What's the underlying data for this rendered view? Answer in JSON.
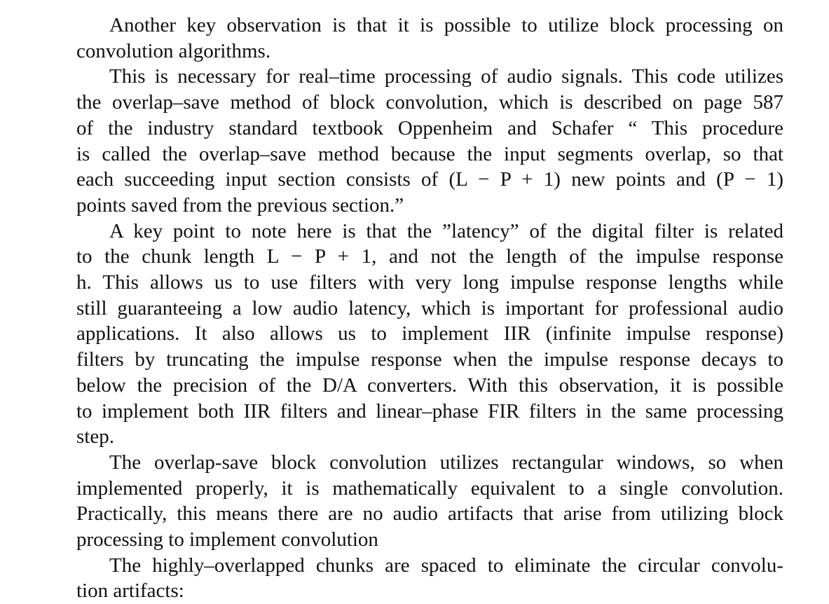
{
  "paragraphs": [
    {
      "lines": [
        "Another key observation is that it is possible to utilize block processing on",
        "convolution algorithms."
      ]
    },
    {
      "lines": [
        "This is necessary for real–time processing of audio signals. This code utilizes",
        "the overlap–save method of block convolution, which is described on page 587",
        "of the industry standard textbook Oppenheim and Schafer “ This procedure",
        "is called the overlap–save method because the input segments overlap, so that",
        "each succeeding input section consists of (L − P + 1) new points and (P − 1)",
        "points saved from the previous section.”"
      ]
    },
    {
      "lines": [
        "A key point to note here is that the ”latency” of the digital filter is related",
        "to the chunk length L − P + 1, and not the length of the impulse response",
        "h. This allows us to use filters with very long impulse response lengths while",
        "still guaranteeing a low audio latency, which is important for professional audio",
        "applications. It also allows us to implement IIR (infinite impulse response)",
        "filters by truncating the impulse response when the impulse response decays to",
        "below the precision of the D/A converters. With this observation, it is possible",
        "to implement both IIR filters and linear–phase FIR filters in the same processing",
        "step."
      ]
    },
    {
      "lines": [
        "The overlap-save block convolution utilizes rectangular windows, so when",
        "implemented properly, it is mathematically equivalent to a single convolution.",
        "Practically, this means there are no audio artifacts that arise from utilizing block",
        "processing to implement convolution"
      ]
    },
    {
      "lines": [
        "The highly–overlapped chunks are spaced to eliminate the circular convolu-",
        "tion artifacts:"
      ]
    }
  ]
}
